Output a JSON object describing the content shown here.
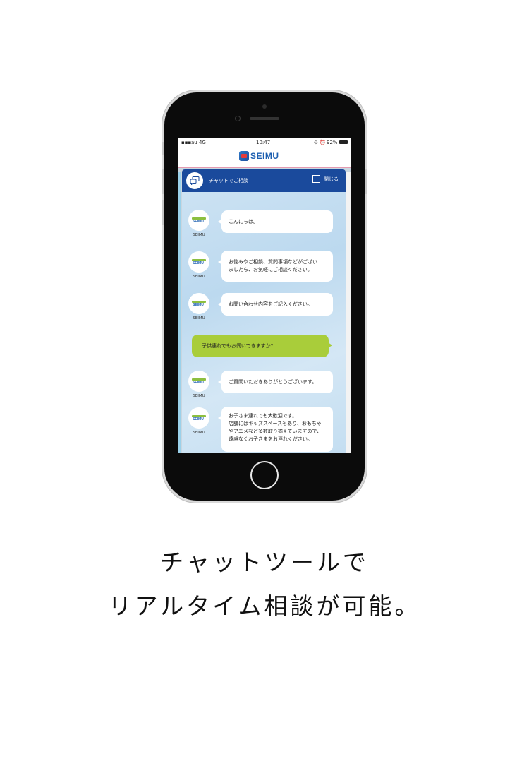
{
  "status_bar": {
    "carrier": "au  4G",
    "time": "10:47",
    "battery": "92%"
  },
  "header": {
    "logo_text": "SEIMU"
  },
  "chat": {
    "title": "チャットでご相談",
    "close_label": "閉じる",
    "sender_name": "SEIMU",
    "avatar_text": "SEIMU",
    "messages": [
      {
        "from": "bot",
        "lines": [
          "こんにちは。"
        ]
      },
      {
        "from": "bot",
        "lines": [
          "お悩みやご相談、質問事項などがござい",
          "ましたら、お気軽にご相談ください。"
        ]
      },
      {
        "from": "bot",
        "lines": [
          "お問い合わせ内容をご記入ください。"
        ]
      },
      {
        "from": "user",
        "lines": [
          "子供連れでもお伺いできますか?"
        ]
      },
      {
        "from": "bot",
        "lines": [
          "ご質問いただきありがとうございます。"
        ]
      },
      {
        "from": "bot",
        "lines": [
          "お子さま連れでも大歓迎です。",
          "店舗にはキッズスペースもあり、おもちゃ",
          "やアニメなど多数取り揃えていますので、",
          "遠慮なくお子さまをお連れください。"
        ]
      }
    ]
  },
  "caption": {
    "line1": "チャットツールで",
    "line2": "リアルタイム相談が可能。"
  },
  "colors": {
    "chat_header": "#1a4a9c",
    "user_bubble": "#a9cd3a",
    "brand_blue": "#1d5fb0"
  }
}
